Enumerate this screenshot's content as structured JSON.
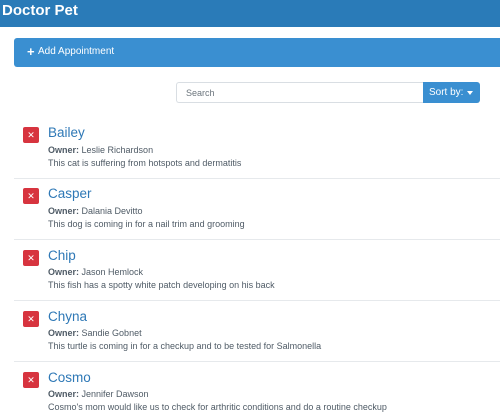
{
  "app": {
    "brand": "Doctor Pet"
  },
  "toolbar": {
    "add_label": "Add Appointment",
    "add_icon": "plus-icon"
  },
  "search": {
    "placeholder": "Search",
    "value": ""
  },
  "sort": {
    "label": "Sort by:"
  },
  "appointments": [
    {
      "pet": "Bailey",
      "owner_label": "Owner:",
      "owner": "Leslie Richardson",
      "note": "This cat is suffering from hotspots and dermatitis"
    },
    {
      "pet": "Casper",
      "owner_label": "Owner:",
      "owner": "Dalania Devitto",
      "note": "This dog is coming in for a nail trim and grooming"
    },
    {
      "pet": "Chip",
      "owner_label": "Owner:",
      "owner": "Jason Hemlock",
      "note": "This fish has a spotty white patch developing on his back"
    },
    {
      "pet": "Chyna",
      "owner_label": "Owner:",
      "owner": "Sandie Gobnet",
      "note": "This turtle is coming in for a checkup and to be tested for Salmonella"
    },
    {
      "pet": "Cosmo",
      "owner_label": "Owner:",
      "owner": "Jennifer Dawson",
      "note": "Cosmo's mom would like us to check for arthritic conditions and do a routine checkup"
    }
  ],
  "colors": {
    "navbar": "#2a7bb8",
    "primary": "#3a8fd1",
    "danger": "#d7343f",
    "link": "#2e78b6"
  }
}
